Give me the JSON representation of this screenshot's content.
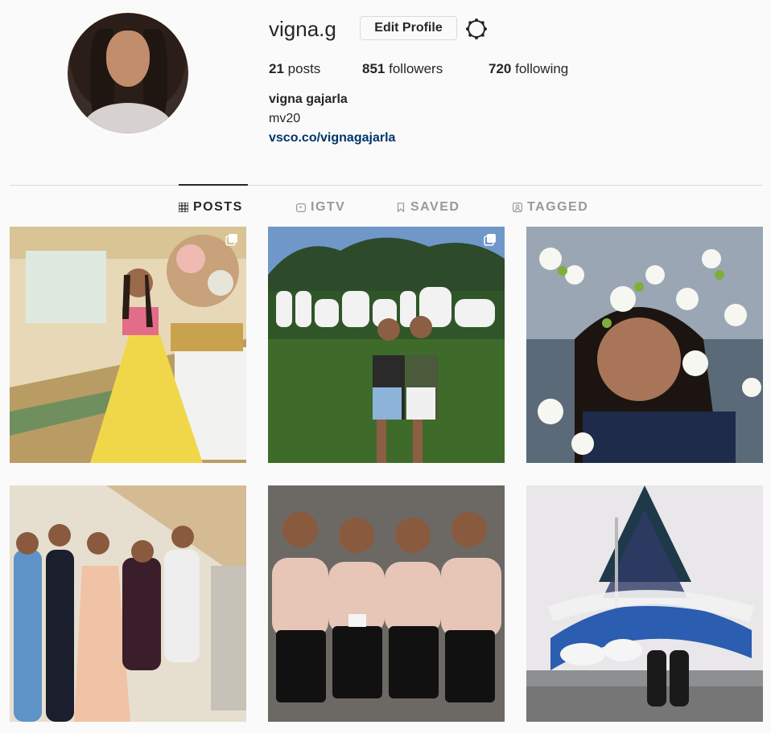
{
  "profile": {
    "username": "vigna.g",
    "edit_label": "Edit Profile",
    "stats": {
      "posts_count": "21",
      "posts_label": "posts",
      "followers_count": "851",
      "followers_label": "followers",
      "following_count": "720",
      "following_label": "following"
    },
    "bio": {
      "full_name": "vigna gajarla",
      "line": "mv20",
      "link": "vsco.co/vignagajarla"
    }
  },
  "tabs": [
    {
      "label": "POSTS",
      "icon": "grid-icon",
      "active": true
    },
    {
      "label": "IGTV",
      "icon": "igtv-icon",
      "active": false
    },
    {
      "label": "SAVED",
      "icon": "bookmark-icon",
      "active": false
    },
    {
      "label": "TAGGED",
      "icon": "tag-icon",
      "active": false
    }
  ],
  "posts": [
    {
      "type": "photo",
      "multiple": true
    },
    {
      "type": "photo",
      "multiple": true
    },
    {
      "type": "photo",
      "multiple": false
    },
    {
      "type": "photo",
      "multiple": false
    },
    {
      "type": "photo",
      "multiple": false
    },
    {
      "type": "photo",
      "multiple": false
    }
  ],
  "colors": {
    "background": "#fafafa",
    "text": "#262626",
    "muted": "#999999",
    "link": "#003569",
    "border": "#dbdbdb"
  }
}
